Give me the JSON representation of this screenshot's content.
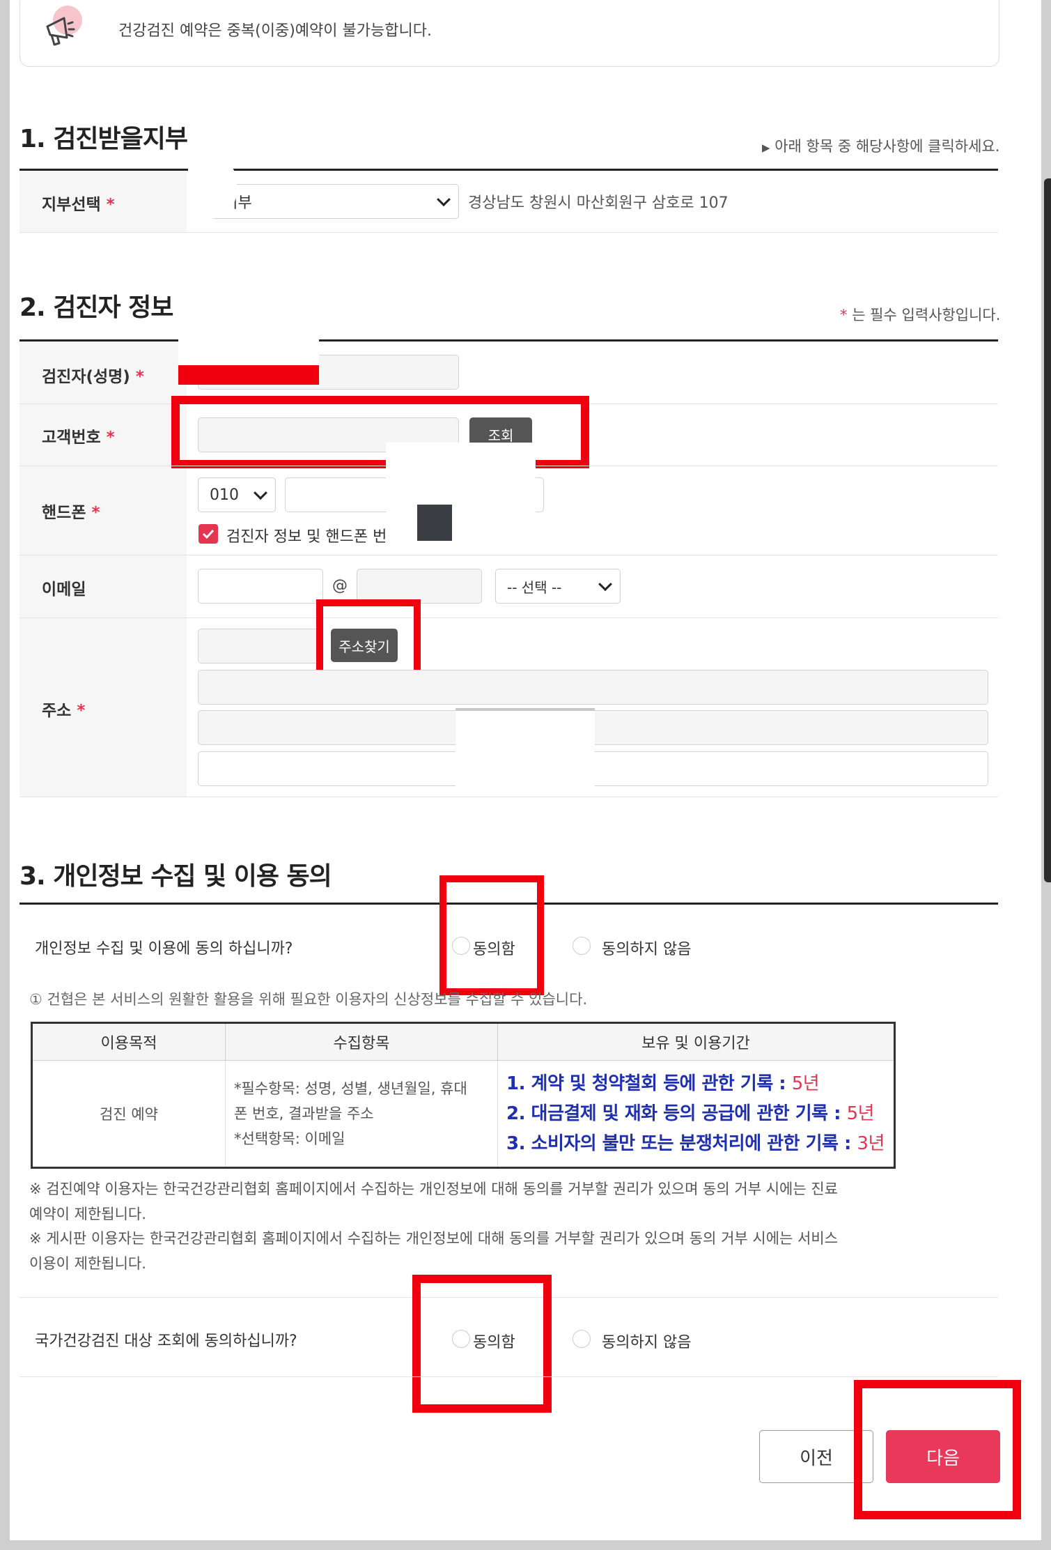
{
  "notice": {
    "text": "건강검진 예약은 중복(이중)예약이 불가능합니다."
  },
  "section1": {
    "title": "1. 검진받을지부",
    "hint": "아래 항목 중 해당사항에 클릭하세요.",
    "branch_label": "지부선택",
    "branch_value": "남지부",
    "branch_address": "경상남도 창원시 마산회원구 삼호로 107"
  },
  "section2": {
    "title": "2. 검진자 정보",
    "required_note": "는 필수 입력사항입니다.",
    "name_label": "검진자(성명)",
    "customer_no_label": "고객번호",
    "lookup_button": "조회",
    "phone_label": "핸드폰",
    "phone_prefix": "010",
    "phone_consent": "검진자 정보 및 핸드폰 번",
    "email_label": "이메일",
    "email_at": "@",
    "email_domain_select": "-- 선택 --",
    "address_label": "주소",
    "address_search_button": "주소찾기",
    "required_mark": "*"
  },
  "section3": {
    "title": "3. 개인정보 수집 및 이용 동의",
    "question1": "개인정보 수집 및 이용에 동의 하십니까?",
    "agree": "동의함",
    "disagree": "동의하지 않음",
    "info": "① 건협은 본 서비스의 원활한 활용을 위해 필요한 이용자의 신상정보를 수집할 수 있습니다.",
    "table": {
      "headers": [
        "이용목적",
        "수집항목",
        "보유 및 이용기간"
      ],
      "purpose": "검진 예약",
      "items_line1": "*필수항목: 성명, 성별, 생년월일, 휴대",
      "items_line2": "폰 번호, 결과받을 주소",
      "items_line3": "*선택항목: 이메일",
      "retention": [
        {
          "text": "1. 계약 및 청약철회 등에 관한 기록 : ",
          "years": "5년"
        },
        {
          "text": "2. 대금결제 및 재화 등의 공급에 관한 기록 : ",
          "years": "5년"
        },
        {
          "text": "3. 소비자의 불만 또는 분쟁처리에 관한 기록 : ",
          "years": "3년"
        }
      ]
    },
    "note1_line1": "※ 검진예약 이용자는 한국건강관리협회 홈페이지에서 수집하는 개인정보에 대해 동의를 거부할 권리가 있으며 동의 거부 시에는 진료",
    "note1_line2": "예약이 제한됩니다.",
    "note2_line1": "※ 게시판 이용자는 한국건강관리협회 홈페이지에서 수집하는 개인정보에 대해 동의를 거부할 권리가 있으며 동의 거부 시에는 서비스",
    "note2_line2": "이용이 제한됩니다.",
    "question2": "국가건강검진 대상 조회에 동의하십니까?"
  },
  "buttons": {
    "prev": "이전",
    "next": "다음"
  },
  "colors": {
    "accent": "#e9395a",
    "annotation": "#f0000f",
    "retention_text": "#1e2fb0"
  }
}
